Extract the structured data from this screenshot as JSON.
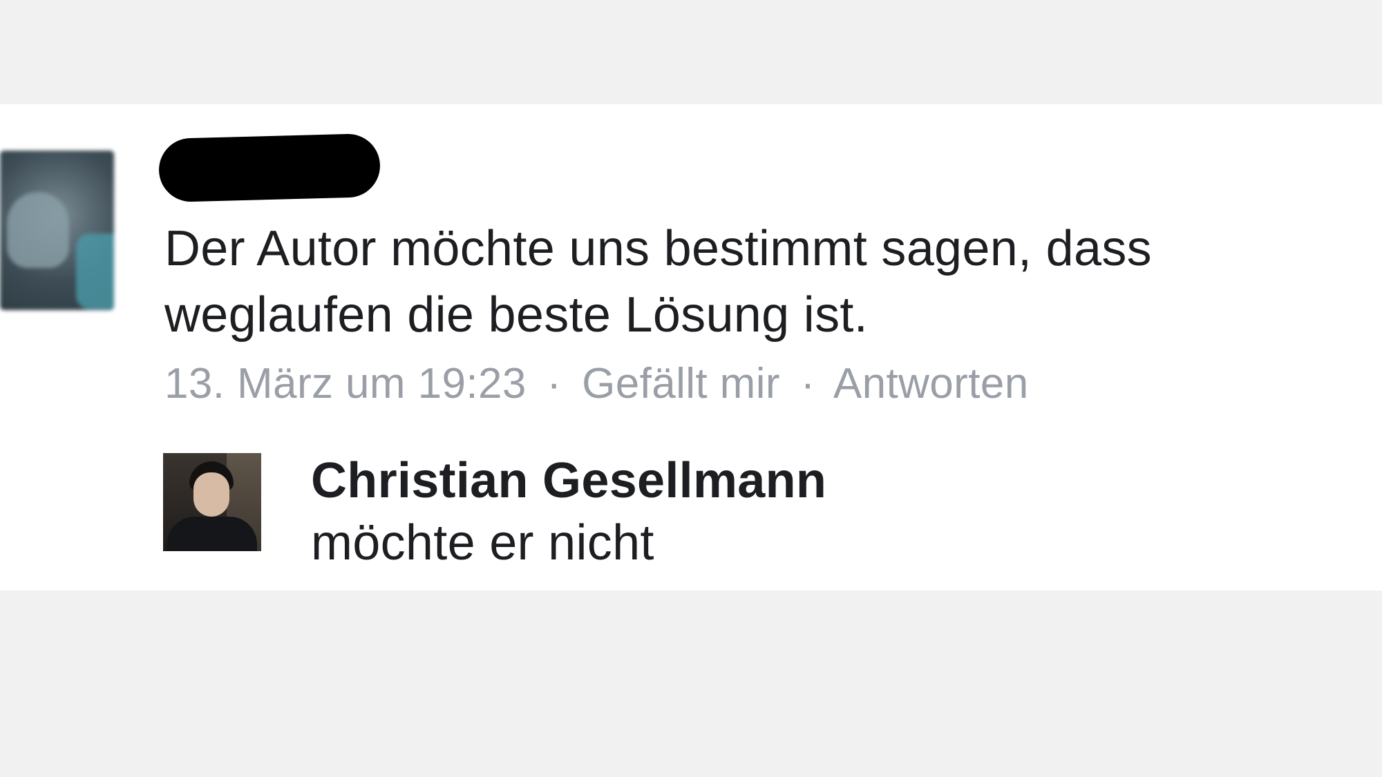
{
  "comment": {
    "author_redacted": true,
    "text": "Der Autor möchte uns bestimmt sagen, dass weglaufen die beste Lösung ist.",
    "meta": {
      "timestamp": "13. März um 19:23",
      "separator": "·",
      "like_label": "Gefällt mir",
      "reply_label": "Antworten"
    }
  },
  "reply": {
    "author": "Christian Gesellmann",
    "text": "möchte er nicht"
  },
  "colors": {
    "page_background": "#f1f1f1",
    "card_background": "#ffffff",
    "text": "#1c1e21",
    "meta_text": "#9a9ea6",
    "redaction": "#000000"
  },
  "icons": {
    "comment_avatar": "blurred-profile-photo",
    "reply_avatar": "profile-photo"
  }
}
